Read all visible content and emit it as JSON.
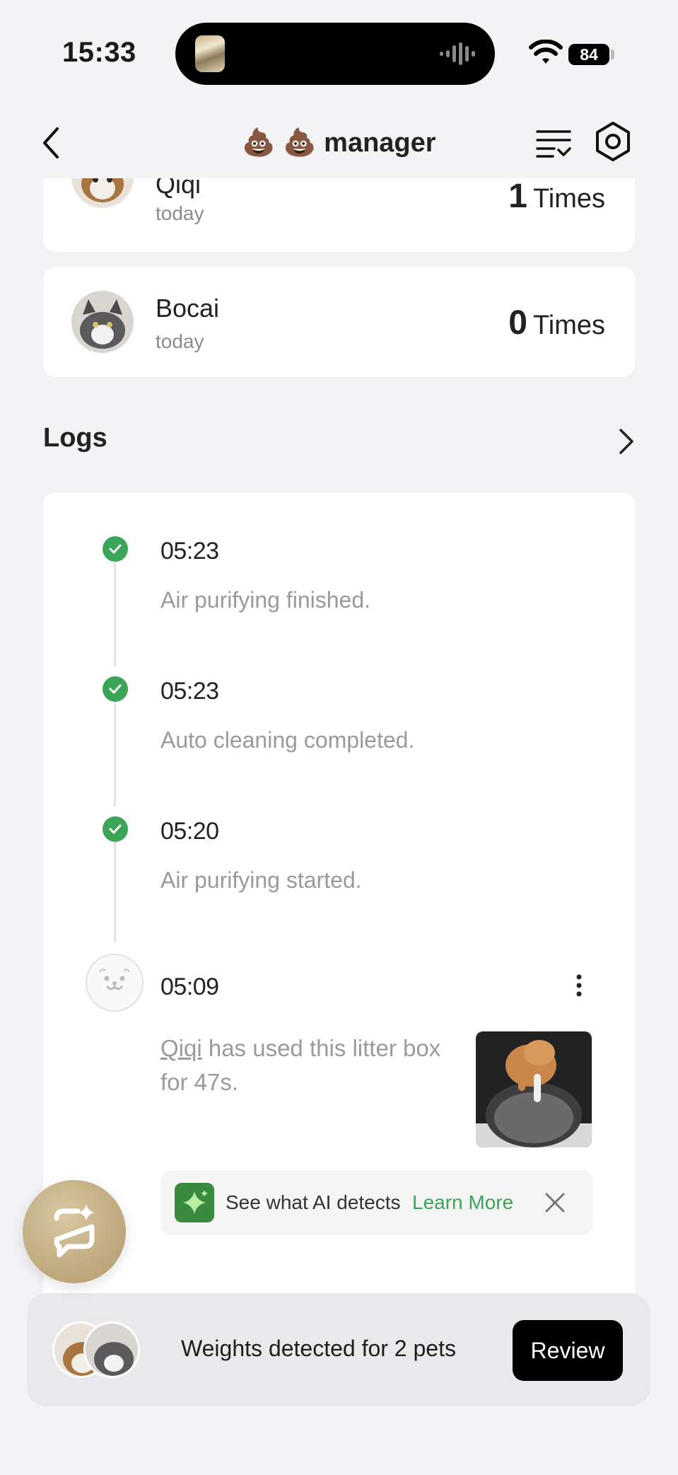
{
  "status_bar": {
    "time": "15:33",
    "battery": "84",
    "icons": [
      "wifi-icon",
      "battery-icon",
      "audio-wave-icon"
    ]
  },
  "nav": {
    "title": "💩 💩 manager",
    "icons": [
      "back-icon",
      "list-icon",
      "settings-icon"
    ]
  },
  "pets": [
    {
      "name": "Qiqi",
      "sub": "today",
      "count": "1",
      "unit": "Times"
    },
    {
      "name": "Bocai",
      "sub": "today",
      "count": "0",
      "unit": "Times"
    }
  ],
  "logs": {
    "title": "Logs",
    "items": [
      {
        "time": "05:23",
        "desc": "Air purifying finished."
      },
      {
        "time": "05:23",
        "desc": "Auto cleaning completed."
      },
      {
        "time": "05:20",
        "desc": "Air purifying started."
      }
    ],
    "usage": {
      "time": "05:09",
      "pet_link": "Qiqi",
      "text": " has used this litter box for 47s."
    },
    "ai_banner": {
      "text": "See what AI detects",
      "link": "Learn More"
    }
  },
  "weights_bar": {
    "text": "Weights detected for 2 pets",
    "button": "Review"
  },
  "colors": {
    "accent_green": "#3aa457",
    "background": "#f3f3f5"
  }
}
